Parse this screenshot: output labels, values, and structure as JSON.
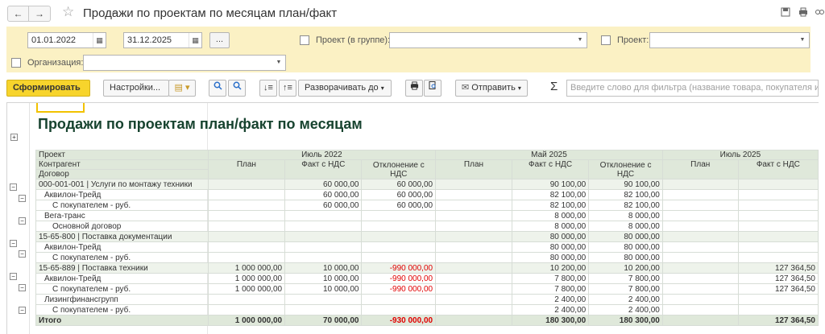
{
  "window": {
    "title": "Продажи по проектам по месяцам план/факт",
    "back_glyph": "←",
    "forward_glyph": "→",
    "favorite_glyph": "☆",
    "icons": [
      "save-icon",
      "print-icon",
      "link-icon",
      "more-icon",
      "close-icon"
    ]
  },
  "filters": {
    "date_from": "01.01.2022",
    "date_to": "31.12.2025",
    "period_dash": "–",
    "period_button": "...",
    "project_group_label": "Проект (в группе):",
    "project_group_value": "",
    "project_label": "Проект:",
    "project_value": "",
    "organization_label": "Организация:",
    "organization_value": ""
  },
  "commands": {
    "generate": "Сформировать",
    "settings": "Настройки...",
    "expand_to": "Разворачивать до",
    "send": "Отправить",
    "sigma": "Σ",
    "search_placeholder": "Введите слово для фильтра (название товара, покупателя и пр.)"
  },
  "report": {
    "title": "Продажи по проектам план/факт по месяцам",
    "row_headers": [
      "Проект",
      "Контрагент",
      "Договор"
    ],
    "periods": [
      "Июль 2022",
      "Май 2025",
      "Июль 2025"
    ],
    "columns": {
      "plan": "План",
      "fact": "Факт с НДС",
      "deviation_line1": "Отклонение с",
      "deviation_line2": "НДС"
    },
    "rows": [
      {
        "level": 0,
        "name": "000-001-001 | Услуги по монтажу техники",
        "j22_plan": "",
        "j22_fact": "60 000,00",
        "j22_dev": "60 000,00",
        "m25_plan": "",
        "m25_fact": "90 100,00",
        "m25_dev": "90 100,00",
        "j25_plan": "",
        "j25_fact": ""
      },
      {
        "level": 1,
        "name": "Аквилон-Трейд",
        "j22_plan": "",
        "j22_fact": "60 000,00",
        "j22_dev": "60 000,00",
        "m25_plan": "",
        "m25_fact": "82 100,00",
        "m25_dev": "82 100,00",
        "j25_plan": "",
        "j25_fact": ""
      },
      {
        "level": 2,
        "name": "С покупателем - руб.",
        "j22_plan": "",
        "j22_fact": "60 000,00",
        "j22_dev": "60 000,00",
        "m25_plan": "",
        "m25_fact": "82 100,00",
        "m25_dev": "82 100,00",
        "j25_plan": "",
        "j25_fact": ""
      },
      {
        "level": 1,
        "name": "Вега-транс",
        "j22_plan": "",
        "j22_fact": "",
        "j22_dev": "",
        "m25_plan": "",
        "m25_fact": "8 000,00",
        "m25_dev": "8 000,00",
        "j25_plan": "",
        "j25_fact": ""
      },
      {
        "level": 2,
        "name": "Основной договор",
        "j22_plan": "",
        "j22_fact": "",
        "j22_dev": "",
        "m25_plan": "",
        "m25_fact": "8 000,00",
        "m25_dev": "8 000,00",
        "j25_plan": "",
        "j25_fact": ""
      },
      {
        "level": 0,
        "name": "15-65-800 | Поставка документации",
        "j22_plan": "",
        "j22_fact": "",
        "j22_dev": "",
        "m25_plan": "",
        "m25_fact": "80 000,00",
        "m25_dev": "80 000,00",
        "j25_plan": "",
        "j25_fact": ""
      },
      {
        "level": 1,
        "name": "Аквилон-Трейд",
        "j22_plan": "",
        "j22_fact": "",
        "j22_dev": "",
        "m25_plan": "",
        "m25_fact": "80 000,00",
        "m25_dev": "80 000,00",
        "j25_plan": "",
        "j25_fact": ""
      },
      {
        "level": 2,
        "name": "С покупателем - руб.",
        "j22_plan": "",
        "j22_fact": "",
        "j22_dev": "",
        "m25_plan": "",
        "m25_fact": "80 000,00",
        "m25_dev": "80 000,00",
        "j25_plan": "",
        "j25_fact": ""
      },
      {
        "level": 0,
        "name": "15-65-889 | Поставка техники",
        "j22_plan": "1 000 000,00",
        "j22_fact": "10 000,00",
        "j22_dev": "-990 000,00",
        "m25_plan": "",
        "m25_fact": "10 200,00",
        "m25_dev": "10 200,00",
        "j25_plan": "",
        "j25_fact": "127 364,50"
      },
      {
        "level": 1,
        "name": "Аквилон-Трейд",
        "j22_plan": "1 000 000,00",
        "j22_fact": "10 000,00",
        "j22_dev": "-990 000,00",
        "m25_plan": "",
        "m25_fact": "7 800,00",
        "m25_dev": "7 800,00",
        "j25_plan": "",
        "j25_fact": "127 364,50"
      },
      {
        "level": 2,
        "name": "С покупателем - руб.",
        "j22_plan": "1 000 000,00",
        "j22_fact": "10 000,00",
        "j22_dev": "-990 000,00",
        "m25_plan": "",
        "m25_fact": "7 800,00",
        "m25_dev": "7 800,00",
        "j25_plan": "",
        "j25_fact": "127 364,50"
      },
      {
        "level": 1,
        "name": "Лизингфинансгрупп",
        "j22_plan": "",
        "j22_fact": "",
        "j22_dev": "",
        "m25_plan": "",
        "m25_fact": "2 400,00",
        "m25_dev": "2 400,00",
        "j25_plan": "",
        "j25_fact": ""
      },
      {
        "level": 2,
        "name": "С покупателем - руб.",
        "j22_plan": "",
        "j22_fact": "",
        "j22_dev": "",
        "m25_plan": "",
        "m25_fact": "2 400,00",
        "m25_dev": "2 400,00",
        "j25_plan": "",
        "j25_fact": ""
      }
    ],
    "total": {
      "name": "Итого",
      "j22_plan": "1 000 000,00",
      "j22_fact": "70 000,00",
      "j22_dev": "-930 000,00",
      "m25_plan": "",
      "m25_fact": "180 300,00",
      "m25_dev": "180 300,00",
      "j25_plan": "",
      "j25_fact": "127 364,50"
    }
  },
  "colors": {
    "accent_button": "#f7d42c",
    "filter_panel": "#fbf1c4",
    "header_bg": "#dfe8da",
    "title_color": "#17432f",
    "negative": "#e00000"
  }
}
